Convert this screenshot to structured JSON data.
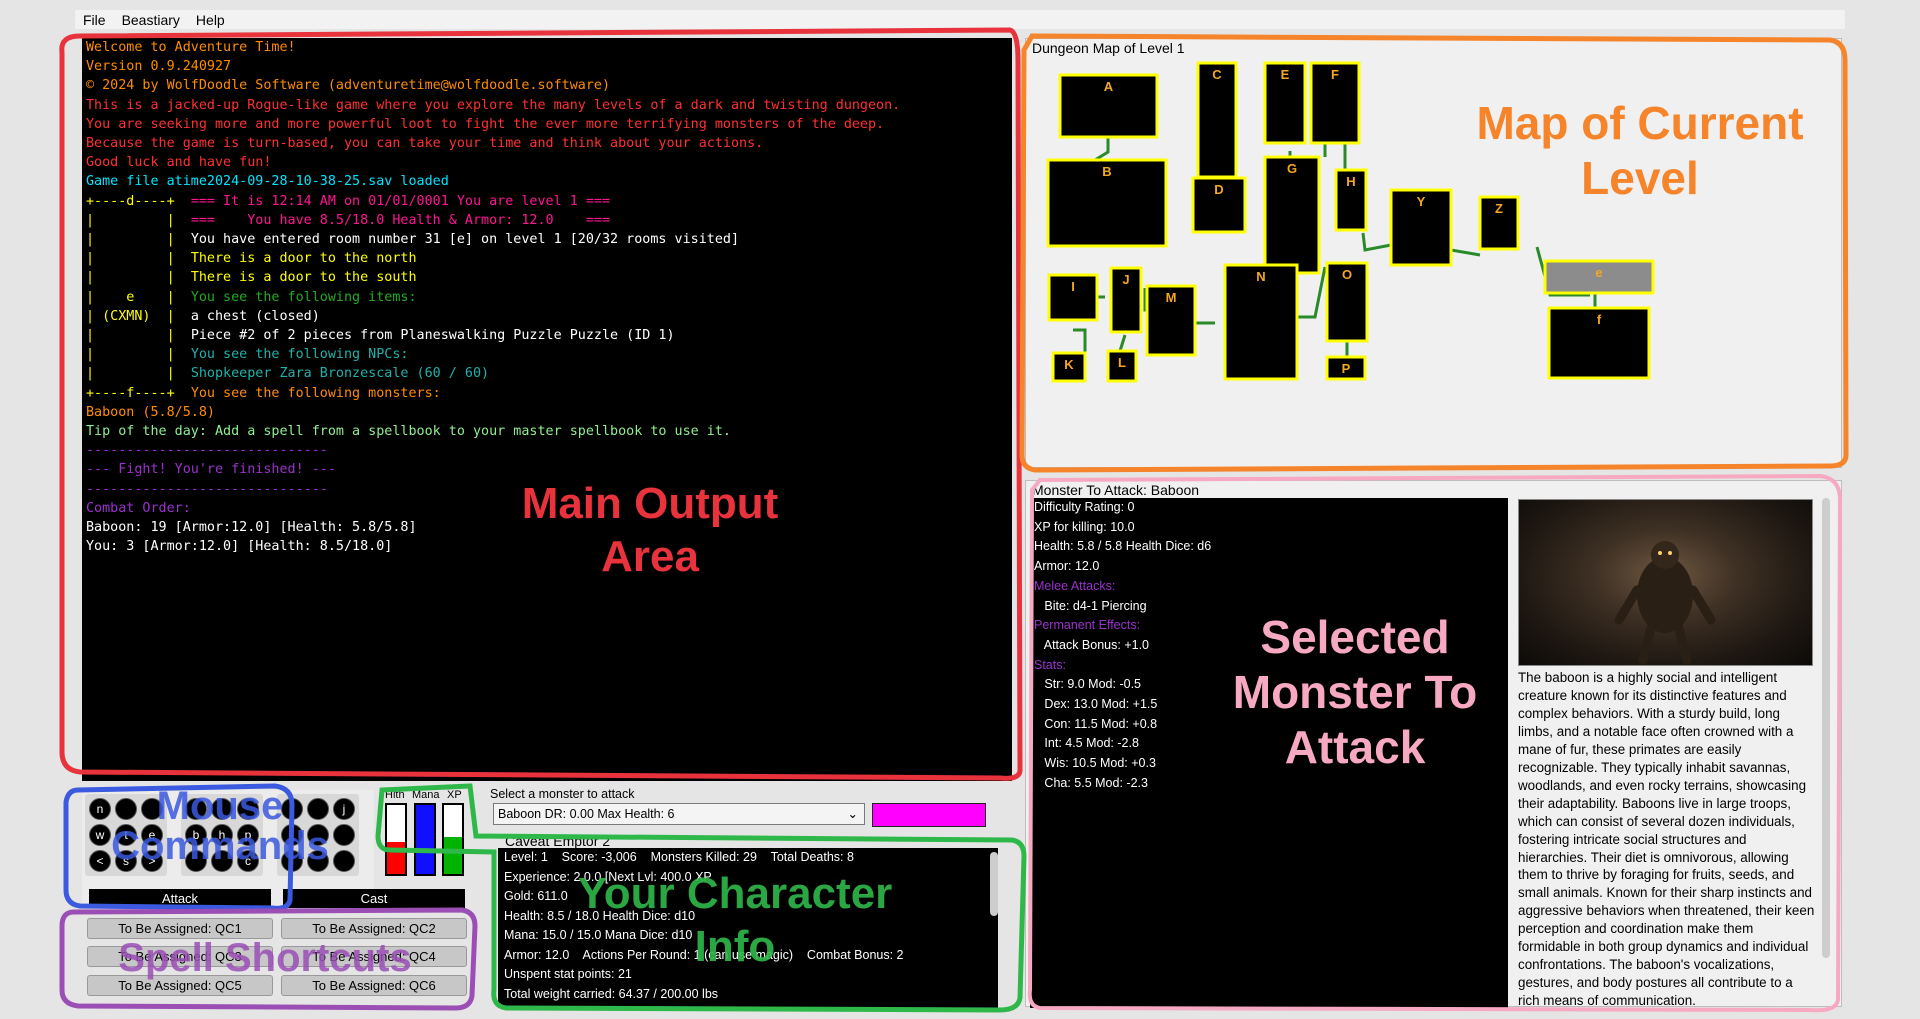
{
  "menu": {
    "file": "File",
    "beastiary": "Beastiary",
    "help": "Help"
  },
  "output": {
    "lines": [
      [
        {
          "t": "Welcome to Adventure Time!",
          "c": "#ff8c00"
        }
      ],
      [
        {
          "t": "Version 0.9.240927",
          "c": "#ff8c00"
        }
      ],
      [
        {
          "t": "© 2024 by WolfDoodle Software (adventuretime@wolfdoodle.software)",
          "c": "#ff8c00"
        }
      ],
      [
        {
          "t": "This is a jacked-up Rogue-like game where you explore the many levels of a dark and twisting dungeon.",
          "c": "#ff3030"
        }
      ],
      [
        {
          "t": "You are seeking more and more powerful loot to fight the ever more terrifying monsters of the deep.",
          "c": "#ff3030"
        }
      ],
      [
        {
          "t": "Because the game is turn-based, you can take your time and think about your actions.",
          "c": "#ff3030"
        }
      ],
      [
        {
          "t": "Good luck and have fun!",
          "c": "#ff3030"
        }
      ],
      [
        {
          "t": "Game file atime2024-09-28-10-38-25.sav loaded",
          "c": "#00e5ff"
        }
      ],
      [
        {
          "t": "+----d----+  ",
          "c": "#ffff00"
        },
        {
          "t": "=== It is 12:14 AM on 01/01/0001 You are level 1 ===",
          "c": "#ff1493"
        }
      ],
      [
        {
          "t": "|         |  ",
          "c": "#ffff00"
        },
        {
          "t": "===    You have 8.5/18.0 Health & Armor: 12.0    ===",
          "c": "#ff1493"
        }
      ],
      [
        {
          "t": "|         |  ",
          "c": "#ffff00"
        },
        {
          "t": "You have entered room number 31 [e] on level 1 [20/32 rooms visited]",
          "c": "#ffffff"
        }
      ],
      [
        {
          "t": "|         |  ",
          "c": "#ffff00"
        },
        {
          "t": "There is a door to the north",
          "c": "#ffff00"
        }
      ],
      [
        {
          "t": "|         |  ",
          "c": "#ffff00"
        },
        {
          "t": "There is a door to the south",
          "c": "#ffff00"
        }
      ],
      [
        {
          "t": "|    e    |  ",
          "c": "#ffff00"
        },
        {
          "t": "You see the following items:",
          "c": "#22aa22"
        }
      ],
      [
        {
          "t": "| (CXMN)  |  ",
          "c": "#ffff00"
        },
        {
          "t": "a chest (closed)",
          "c": "#ffffff"
        }
      ],
      [
        {
          "t": "|         |  ",
          "c": "#ffff00"
        },
        {
          "t": "Piece #2 of 2 pieces from Planeswalking Puzzle Puzzle (ID 1)",
          "c": "#ffffff"
        }
      ],
      [
        {
          "t": "|         |  ",
          "c": "#ffff00"
        },
        {
          "t": "You see the following NPCs:",
          "c": "#20b2aa"
        }
      ],
      [
        {
          "t": "|         |  ",
          "c": "#ffff00"
        },
        {
          "t": "Shopkeeper Zara Bronzescale (60 / 60)",
          "c": "#20b2aa"
        }
      ],
      [
        {
          "t": "+----f----+  ",
          "c": "#ffff00"
        },
        {
          "t": "You see the following monsters:",
          "c": "#ff8c00"
        }
      ],
      [
        {
          "t": "Baboon (5.8/5.8)",
          "c": "#ff8c00"
        }
      ],
      [
        {
          "t": "Tip of the day: Add a spell from a spellbook to your master spellbook to use it.",
          "c": "#90ee90"
        }
      ],
      [
        {
          "t": "------------------------------",
          "c": "#9932cc"
        }
      ],
      [
        {
          "t": "--- Fight! You're finished! ---",
          "c": "#9932cc"
        }
      ],
      [
        {
          "t": "------------------------------",
          "c": "#9932cc"
        }
      ],
      [
        {
          "t": "Combat Order:",
          "c": "#9932cc"
        }
      ],
      [
        {
          "t": "Baboon: 19 [Armor:12.0] [Health: 5.8/5.8]",
          "c": "#ffffff"
        }
      ],
      [
        {
          "t": "You: 3 [Armor:12.0] [Health: 8.5/18.0]",
          "c": "#ffffff"
        }
      ]
    ]
  },
  "map": {
    "title": "Dungeon Map of Level 1",
    "rooms": [
      "A",
      "B",
      "C",
      "D",
      "E",
      "F",
      "G",
      "H",
      "Y",
      "Z",
      "e",
      "f",
      "I",
      "J",
      "K",
      "L",
      "M",
      "N",
      "O",
      "P"
    ]
  },
  "monster": {
    "title": "Monster To Attack: Baboon",
    "stats": [
      {
        "t": "Difficulty Rating: 0",
        "c": "#ffffff"
      },
      {
        "t": "XP for killing: 10.0",
        "c": "#ffffff"
      },
      {
        "t": "Health: 5.8 / 5.8 Health Dice: d6",
        "c": "#ffffff"
      },
      {
        "t": "Armor: 12.0",
        "c": "#ffffff"
      },
      {
        "t": "Melee Attacks:",
        "c": "#9932cc"
      },
      {
        "t": "   Bite: d4-1 Piercing",
        "c": "#ffffff"
      },
      {
        "t": "Permanent Effects:",
        "c": "#9932cc"
      },
      {
        "t": "   Attack Bonus: +1.0",
        "c": "#ffffff"
      },
      {
        "t": "Stats:",
        "c": "#9932cc"
      },
      {
        "t": "   Str: 9.0 Mod: -0.5",
        "c": "#ffffff"
      },
      {
        "t": "   Dex: 13.0 Mod: +1.5",
        "c": "#ffffff"
      },
      {
        "t": "   Con: 11.5 Mod: +0.8",
        "c": "#ffffff"
      },
      {
        "t": "   Int: 4.5 Mod: -2.8",
        "c": "#ffffff"
      },
      {
        "t": "   Wis: 10.5 Mod: +0.3",
        "c": "#ffffff"
      },
      {
        "t": "   Cha: 5.5 Mod: -2.3",
        "c": "#ffffff"
      }
    ],
    "description": "The baboon is a highly social and intelligent creature known for its distinctive features and complex behaviors. With a sturdy build, long limbs, and a notable face often crowned with a mane of fur, these primates are easily recognizable. They typically inhabit savannas, woodlands, and even rocky terrains, showcasing their adaptability. Baboons live in large troops, which can consist of several dozen individuals, fostering intricate social structures and hierarchies. Their diet is omnivorous, allowing them to thrive by foraging for fruits, seeds, and small animals. Known for their sharp instincts and aggressive behaviors when threatened, their keen perception and coordination make them formidable in both group dynamics and individual confrontations. The baboon's vocalizations, gestures, and body postures all contribute to a rich means of communication."
  },
  "keys": {
    "left": [
      "n",
      "",
      "",
      "w",
      "t",
      "e",
      "<",
      "s",
      ">"
    ],
    "mid": [
      "",
      "",
      "",
      "b",
      "h",
      "p",
      "",
      "",
      "c"
    ],
    "right": [
      "",
      "",
      "j",
      "",
      "",
      "",
      "",
      "",
      ""
    ]
  },
  "bars": {
    "hlth": "Hlth",
    "mana": "Mana",
    "xp": "XP",
    "hlth_value": 0.47,
    "mana_value": 1.0,
    "xp_value": 0.53
  },
  "actions": {
    "attack": "Attack",
    "cast": "Cast"
  },
  "qc": [
    "To Be Assigned: QC1",
    "To Be Assigned: QC2",
    "To Be Assigned: QC3",
    "To Be Assigned: QC4",
    "To Be Assigned: QC5",
    "To Be Assigned: QC6"
  ],
  "select": {
    "label": "Select a monster to attack",
    "value": "Baboon  DR: 0.00  Max Health: 6"
  },
  "character": {
    "name": "Caveat Emptor 2",
    "lines": [
      "Level: 1    Score: -3,006    Monsters Killed: 29    Total Deaths: 8",
      "Experience: 2 0.0 [Next Lvl: 400.0 XP",
      "Gold: 611.0",
      "Health: 8.5 / 18.0 Health Dice: d10",
      "Mana: 15.0 / 15.0 Mana Dice: d10",
      "Armor: 12.0    Actions Per Round: 1 (can use magic)    Combat Bonus: 2",
      "Unspent stat points: 21",
      "Total weight carried: 64.37 / 200.00 lbs"
    ]
  },
  "annotations": {
    "main": "Main Output Area",
    "map": "Map of Current Level",
    "monster": "Selected Monster To Attack",
    "mouse": "Mouse Commands",
    "spell": "Spell Shortcuts",
    "char": "Your Character Info"
  },
  "colors": {
    "red": "#e8323c",
    "orange": "#f5842a",
    "pink": "#f7a9c1",
    "blue": "#3b5ae0",
    "purple": "#9b4fb5",
    "green": "#2fb84a"
  }
}
